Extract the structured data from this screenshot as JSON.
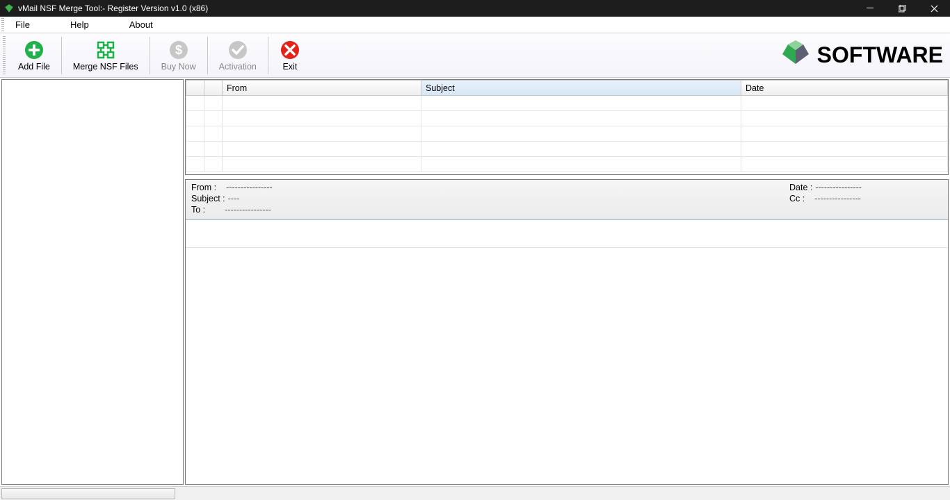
{
  "window": {
    "title": "vMail NSF Merge Tool:- Register Version v1.0 (x86)"
  },
  "menu": {
    "file": "File",
    "help": "Help",
    "about": "About"
  },
  "toolbar": {
    "add_file": "Add File",
    "merge": "Merge NSF Files",
    "buy_now": "Buy Now",
    "activation": "Activation",
    "exit": "Exit"
  },
  "brand": {
    "text": "SOFTWARE"
  },
  "grid": {
    "columns": {
      "from": "From",
      "subject": "Subject",
      "date": "Date"
    }
  },
  "detail": {
    "from_label": "From :",
    "from_value": "----------------",
    "date_label": "Date :",
    "date_value": "----------------",
    "subject_label": "Subject :",
    "subject_value": "----",
    "cc_label": "Cc :",
    "cc_value": "----------------",
    "to_label": "To :",
    "to_value": "----------------"
  }
}
